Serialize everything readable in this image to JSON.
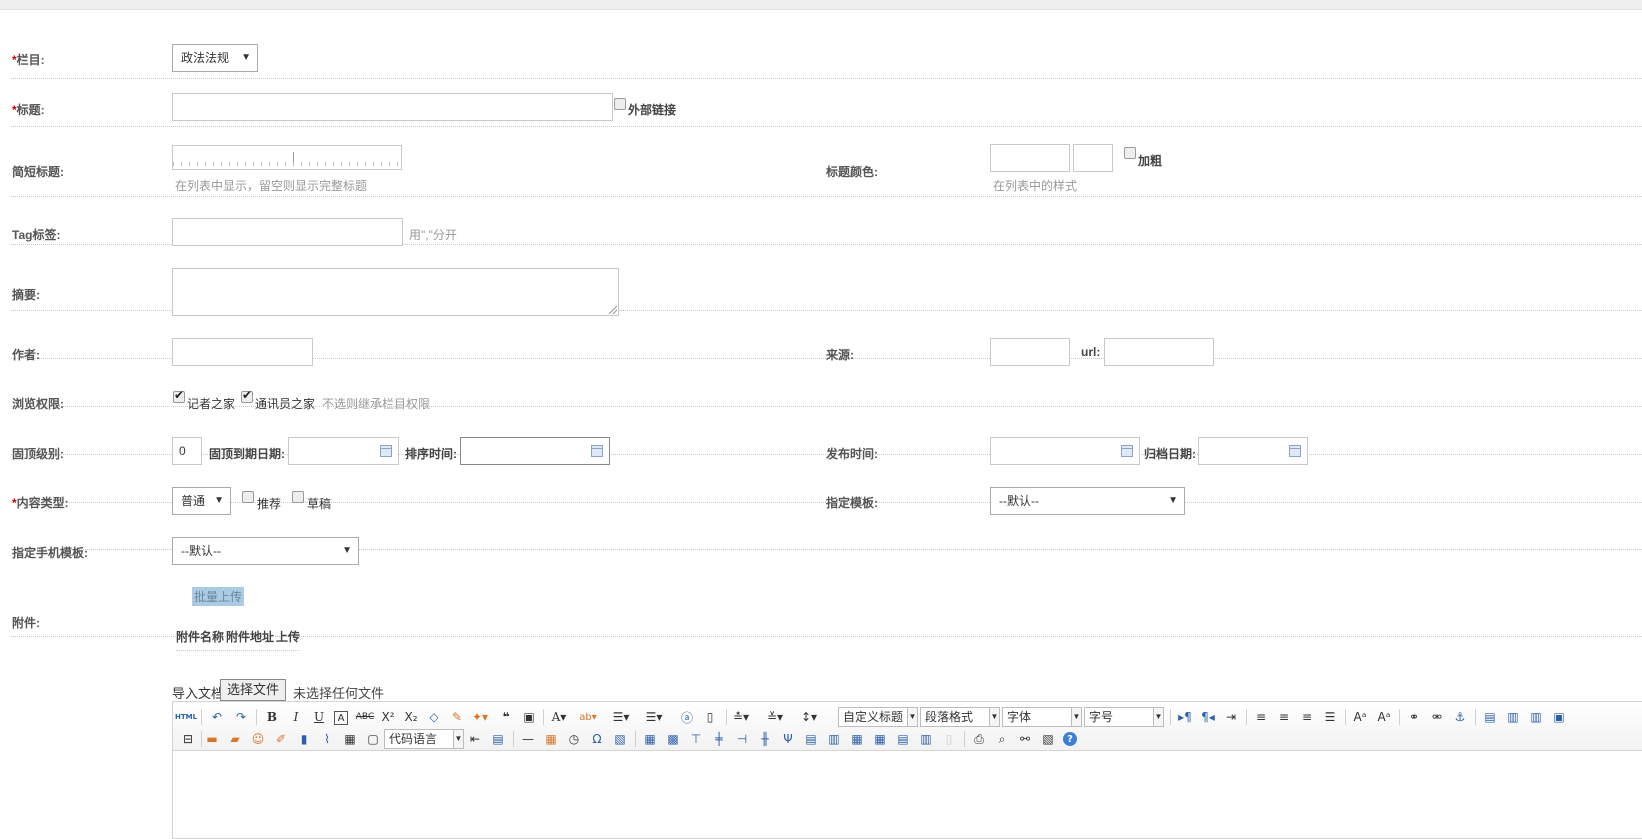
{
  "form": {
    "column": {
      "label": "栏目:",
      "required": "*",
      "value": "政法法规"
    },
    "title": {
      "label": "标题:",
      "required": "*",
      "external_link": "外部链接"
    },
    "short_title": {
      "label": "简短标题:",
      "hint": "在列表中显示，留空则显示完整标题"
    },
    "title_color": {
      "label": "标题颜色:",
      "bold": "加粗",
      "hint": "在列表中的样式"
    },
    "tags": {
      "label": "Tag标签:",
      "hint": "用\",\"分开"
    },
    "summary": {
      "label": "摘要:"
    },
    "author": {
      "label": "作者:"
    },
    "source": {
      "label": "来源:",
      "url_label": "url:"
    },
    "permission": {
      "label": "浏览权限:",
      "opt1": "记者之家",
      "opt2": "通讯员之家",
      "hint": "不选则继承栏目权限"
    },
    "top_level": {
      "label": "固顶级别:",
      "value": "0",
      "expire_label": "固顶到期日期:",
      "sort_label": "排序时间:"
    },
    "publish": {
      "label": "发布时间:",
      "archive_label": "归档日期:"
    },
    "content_type": {
      "label": "内容类型:",
      "required": "*",
      "value": "普通",
      "recommend": "推荐",
      "draft": "草稿"
    },
    "template": {
      "label": "指定模板:",
      "value": "--默认--"
    },
    "mobile_template": {
      "label": "指定手机模板:",
      "value": "--默认--"
    },
    "attachments": {
      "label": "附件:",
      "upload_button": "批量上传",
      "col_name": "附件名称",
      "col_url": "附件地址",
      "col_upload": "上传"
    },
    "import": {
      "label": "导入文档",
      "button": "选择文件",
      "status": "未选择任何文件"
    }
  },
  "editor": {
    "combo_custom_title": "自定义标题",
    "combo_paragraph": "段落格式",
    "combo_font": "字体",
    "combo_size": "字号",
    "combo_code": "代码语言",
    "html_icon": "HTML"
  }
}
